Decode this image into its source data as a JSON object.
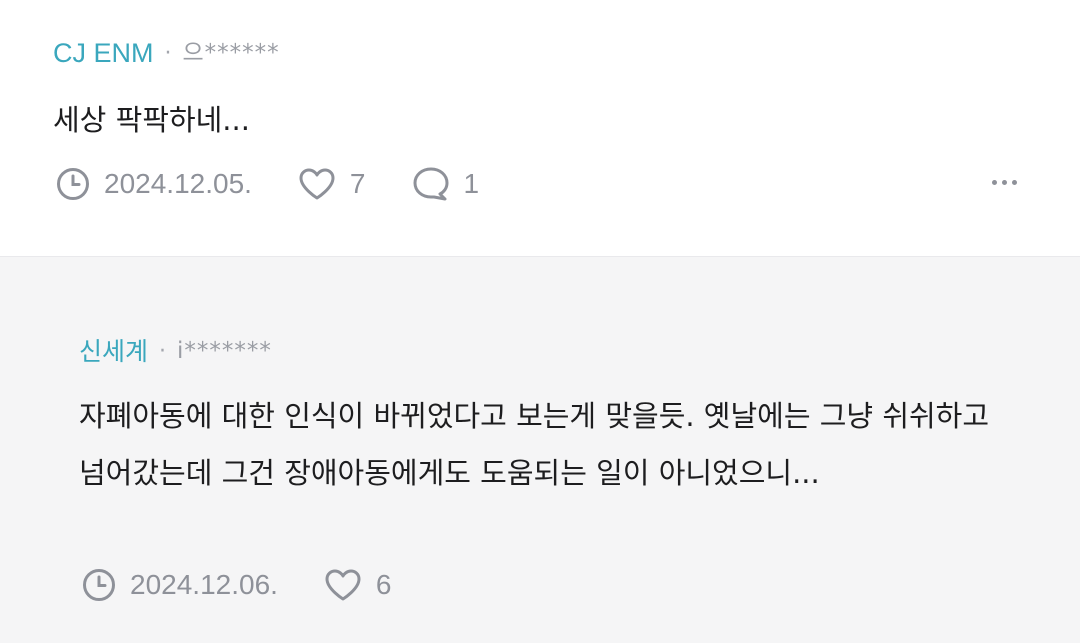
{
  "comments": [
    {
      "company": "CJ ENM",
      "separator": "·",
      "user": "으******",
      "text": "세상 팍팍하네...",
      "date": "2024.12.05.",
      "likes": "7",
      "replies": "1"
    },
    {
      "company": "신세계",
      "separator": "·",
      "user": "i*******",
      "text": "자폐아동에 대한 인식이 바뀌었다고 보는게 맞을듯. 옛날에는 그냥 쉬쉬하고 넘어갔는데 그건 장애아동에게도 도움되는 일이 아니었으니...",
      "date": "2024.12.06.",
      "likes": "6"
    }
  ],
  "icons": {
    "clock": "clock-icon",
    "heart": "heart-icon",
    "reply": "speech-bubble-icon",
    "more": "more-dots-icon"
  },
  "colors": {
    "company": "#3aa7bd",
    "meta_gray": "#8e9199",
    "text": "#1d1d1f",
    "reply_bg": "#f5f5f6"
  }
}
